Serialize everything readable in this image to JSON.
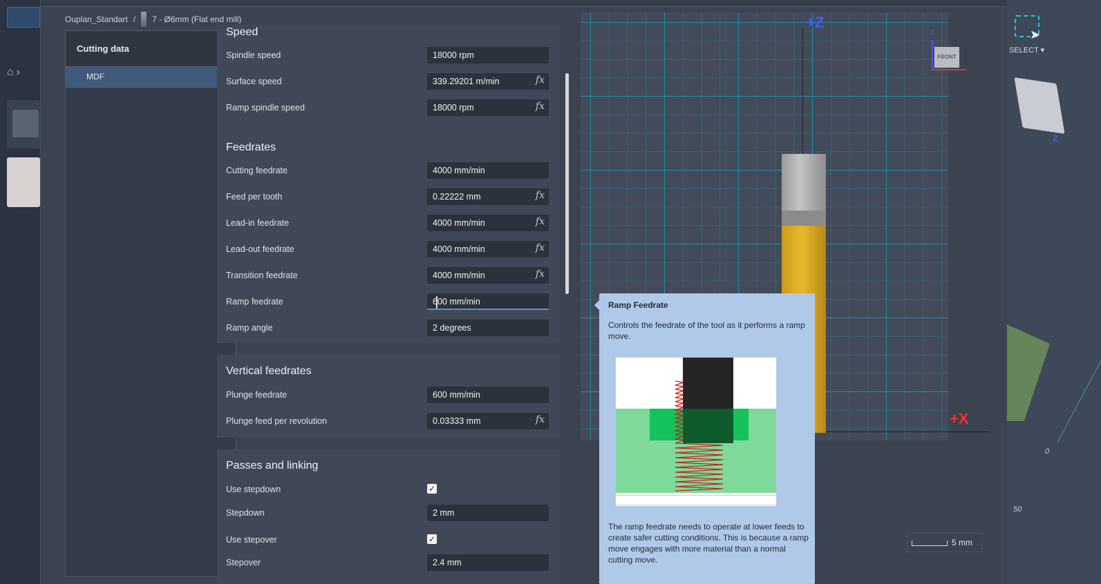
{
  "breadcrumb": {
    "library": "Ouplan_Standart",
    "separator": "/",
    "tool": "7 - Ø6mm (Flat end mill)"
  },
  "tree": {
    "header": "Cutting data",
    "items": [
      {
        "label": "MDF"
      }
    ]
  },
  "sections": {
    "speed": {
      "title": "Speed",
      "rows": [
        {
          "label": "Spindle speed",
          "value": "18000 rpm"
        },
        {
          "label": "Surface speed",
          "value": "339.29201 m/min"
        },
        {
          "label": "Ramp spindle speed",
          "value": "18000 rpm"
        }
      ]
    },
    "feedrates": {
      "title": "Feedrates",
      "rows": [
        {
          "label": "Cutting feedrate",
          "value": "4000 mm/min"
        },
        {
          "label": "Feed per tooth",
          "value": "0.22222 mm"
        },
        {
          "label": "Lead-in feedrate",
          "value": "4000 mm/min"
        },
        {
          "label": "Lead-out feedrate",
          "value": "4000 mm/min"
        },
        {
          "label": "Transition feedrate",
          "value": "4000 mm/min"
        },
        {
          "label": "Ramp feedrate",
          "value": "600 mm/min"
        },
        {
          "label": "Ramp angle",
          "value": "2 degrees"
        }
      ]
    },
    "vertical": {
      "title": "Vertical feedrates",
      "rows": [
        {
          "label": "Plunge feedrate",
          "value": "600 mm/min"
        },
        {
          "label": "Plunge feed per revolution",
          "value": "0.03333 mm"
        }
      ]
    },
    "passes": {
      "title": "Passes and linking",
      "rows": [
        {
          "label": "Use stepdown",
          "checked": true
        },
        {
          "label": "Stepdown",
          "value": "2 mm"
        },
        {
          "label": "Use stepover",
          "checked": true
        },
        {
          "label": "Stepover",
          "value": "2.4 mm"
        }
      ]
    }
  },
  "fx_symbol": "fx",
  "check_symbol": "✓",
  "tooltip": {
    "title": "Ramp Feedrate",
    "description": "Controls the feedrate of the tool as it performs a ramp move.",
    "note": "The ramp feedrate needs to operate at lower feeds to create safer cutting conditions. This is because a ramp move engages with more material than a normal cutting move."
  },
  "viewport": {
    "axis_z": "+Z",
    "axis_x": "+X",
    "viewcube_face": "FRONT",
    "viewcube_axis": "Z",
    "cube_axis": "Z",
    "scale_label": "5 mm",
    "tick_0": "0",
    "tick_50": "50",
    "select_label": "SELECT ▾"
  },
  "colors": {
    "accent": "#3f5a7a",
    "tooltip_bg": "#b1c9e9",
    "grid": "#1f8fa6",
    "axis_z": "#4a55ff",
    "axis_x": "#ff2a2a"
  }
}
